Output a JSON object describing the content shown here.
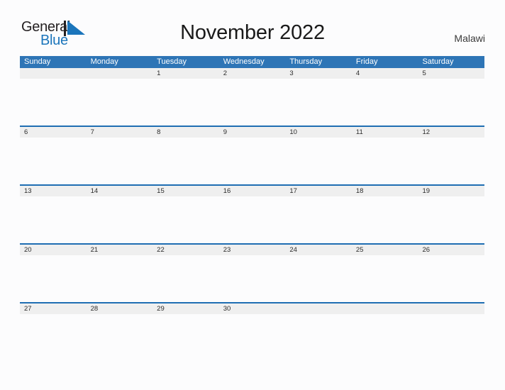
{
  "brand": {
    "word_one": "General",
    "word_two": "Blue",
    "mark_icon": "triangle-flag-icon",
    "color_dark": "#231f20",
    "color_blue": "#1b75bb"
  },
  "header": {
    "title": "November 2022",
    "region": "Malawi"
  },
  "theme": {
    "header_blue": "#2e75b6",
    "divider_blue": "#1f6eb3",
    "date_strip_gray": "#efefef",
    "page_background": "#fcfcfd"
  },
  "calendar": {
    "month": "November",
    "year": "2022",
    "weekday_headers": [
      "Sunday",
      "Monday",
      "Tuesday",
      "Wednesday",
      "Thursday",
      "Friday",
      "Saturday"
    ],
    "weeks": [
      {
        "days": [
          "",
          "",
          "1",
          "2",
          "3",
          "4",
          "5"
        ]
      },
      {
        "days": [
          "6",
          "7",
          "8",
          "9",
          "10",
          "11",
          "12"
        ]
      },
      {
        "days": [
          "13",
          "14",
          "15",
          "16",
          "17",
          "18",
          "19"
        ]
      },
      {
        "days": [
          "20",
          "21",
          "22",
          "23",
          "24",
          "25",
          "26"
        ]
      },
      {
        "days": [
          "27",
          "28",
          "29",
          "30",
          "",
          "",
          ""
        ]
      }
    ]
  }
}
